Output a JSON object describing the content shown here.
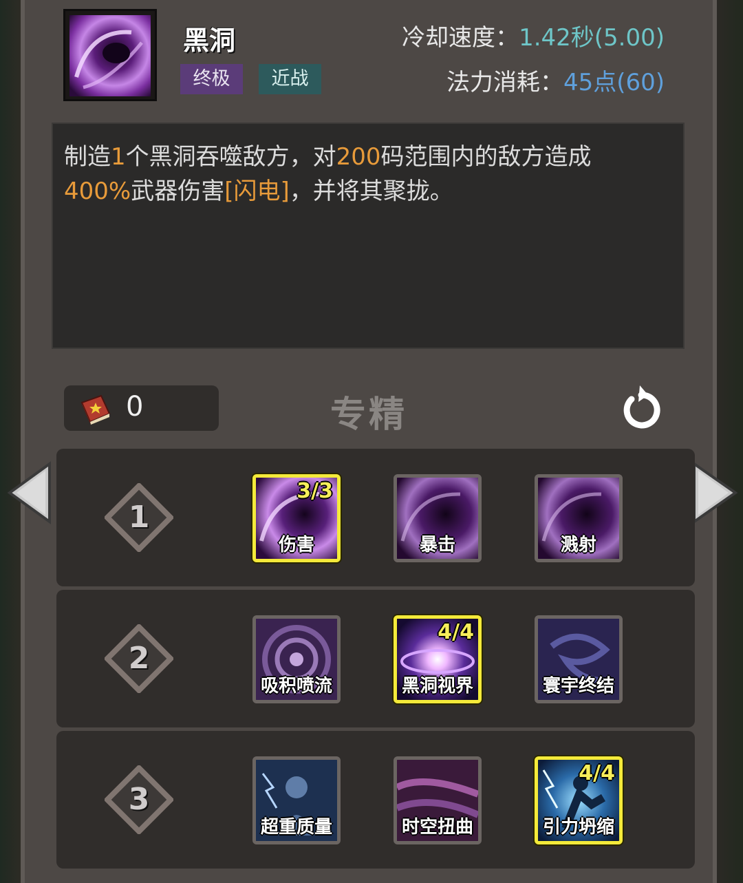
{
  "skill": {
    "name": "黑洞",
    "tags": [
      "终极",
      "近战"
    ],
    "cooldown_label": "冷却速度：",
    "cooldown_value": "1.42秒",
    "cooldown_base": "(5.00)",
    "mana_label": "法力消耗：",
    "mana_value": "45点",
    "mana_base": "(60)",
    "icon": "black-hole-vortex"
  },
  "description": {
    "p1": "制造",
    "n1": "1",
    "p2": "个黑洞吞噬敌方，对",
    "n2": "200",
    "p3": "码范围内的敌方造成",
    "n3": "400%",
    "p4": "武器伤害",
    "element": "[闪电]",
    "p5": "，并将其聚拢。"
  },
  "specialization": {
    "title": "专精",
    "points": "0",
    "points_icon": "skill-book-icon",
    "reset_icon": "reset-icon"
  },
  "tiers": [
    {
      "level": "1",
      "options": [
        {
          "label": "伤害",
          "count": "3/3",
          "selected": true
        },
        {
          "label": "暴击",
          "count": "",
          "selected": false
        },
        {
          "label": "溅射",
          "count": "",
          "selected": false
        }
      ]
    },
    {
      "level": "2",
      "options": [
        {
          "label": "吸积喷流",
          "count": "",
          "selected": false
        },
        {
          "label": "黑洞视界",
          "count": "4/4",
          "selected": true
        },
        {
          "label": "寰宇终结",
          "count": "",
          "selected": false
        }
      ]
    },
    {
      "level": "3",
      "options": [
        {
          "label": "超重质量",
          "count": "",
          "selected": false
        },
        {
          "label": "时空扭曲",
          "count": "",
          "selected": false
        },
        {
          "label": "引力坍缩",
          "count": "4/4",
          "selected": true
        }
      ]
    }
  ],
  "colors": {
    "highlight_number": "#e89b3a",
    "cooldown_value": "#6ec6c8",
    "mana_value": "#5fa0dc",
    "selected_border": "#f4ea3a",
    "tag_ultimate": "#5b3c79",
    "tag_melee": "#2d5a5c"
  }
}
